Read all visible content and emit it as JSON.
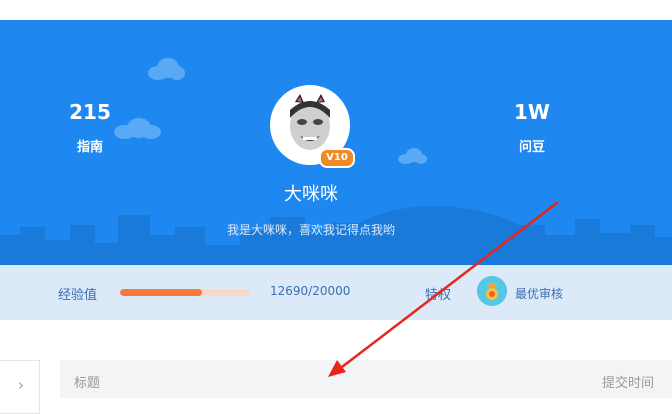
{
  "profile": {
    "stats_left": {
      "value": "215",
      "label": "指南"
    },
    "stats_right": {
      "value": "1W",
      "label": "问豆"
    },
    "avatar_icon": "meme-face-avatar",
    "vip_badge": "V10",
    "username": "大咪咪",
    "bio": "我是大咪咪，喜欢我记得点我哟"
  },
  "level": {
    "exp_label": "经验值",
    "exp_value": "12690/20000",
    "exp_progress": 0.6345,
    "privilege_label": "特权",
    "privilege_icon": "medal-icon",
    "privilege_name": "最优审核"
  },
  "table": {
    "col_title": "标题",
    "col_time": "提交时间",
    "side_icon": "chevron-right-icon"
  },
  "colors": {
    "banner": "#1e88f0",
    "progress_fill": "#f47a3c",
    "annotation_arrow": "#e8251b"
  }
}
